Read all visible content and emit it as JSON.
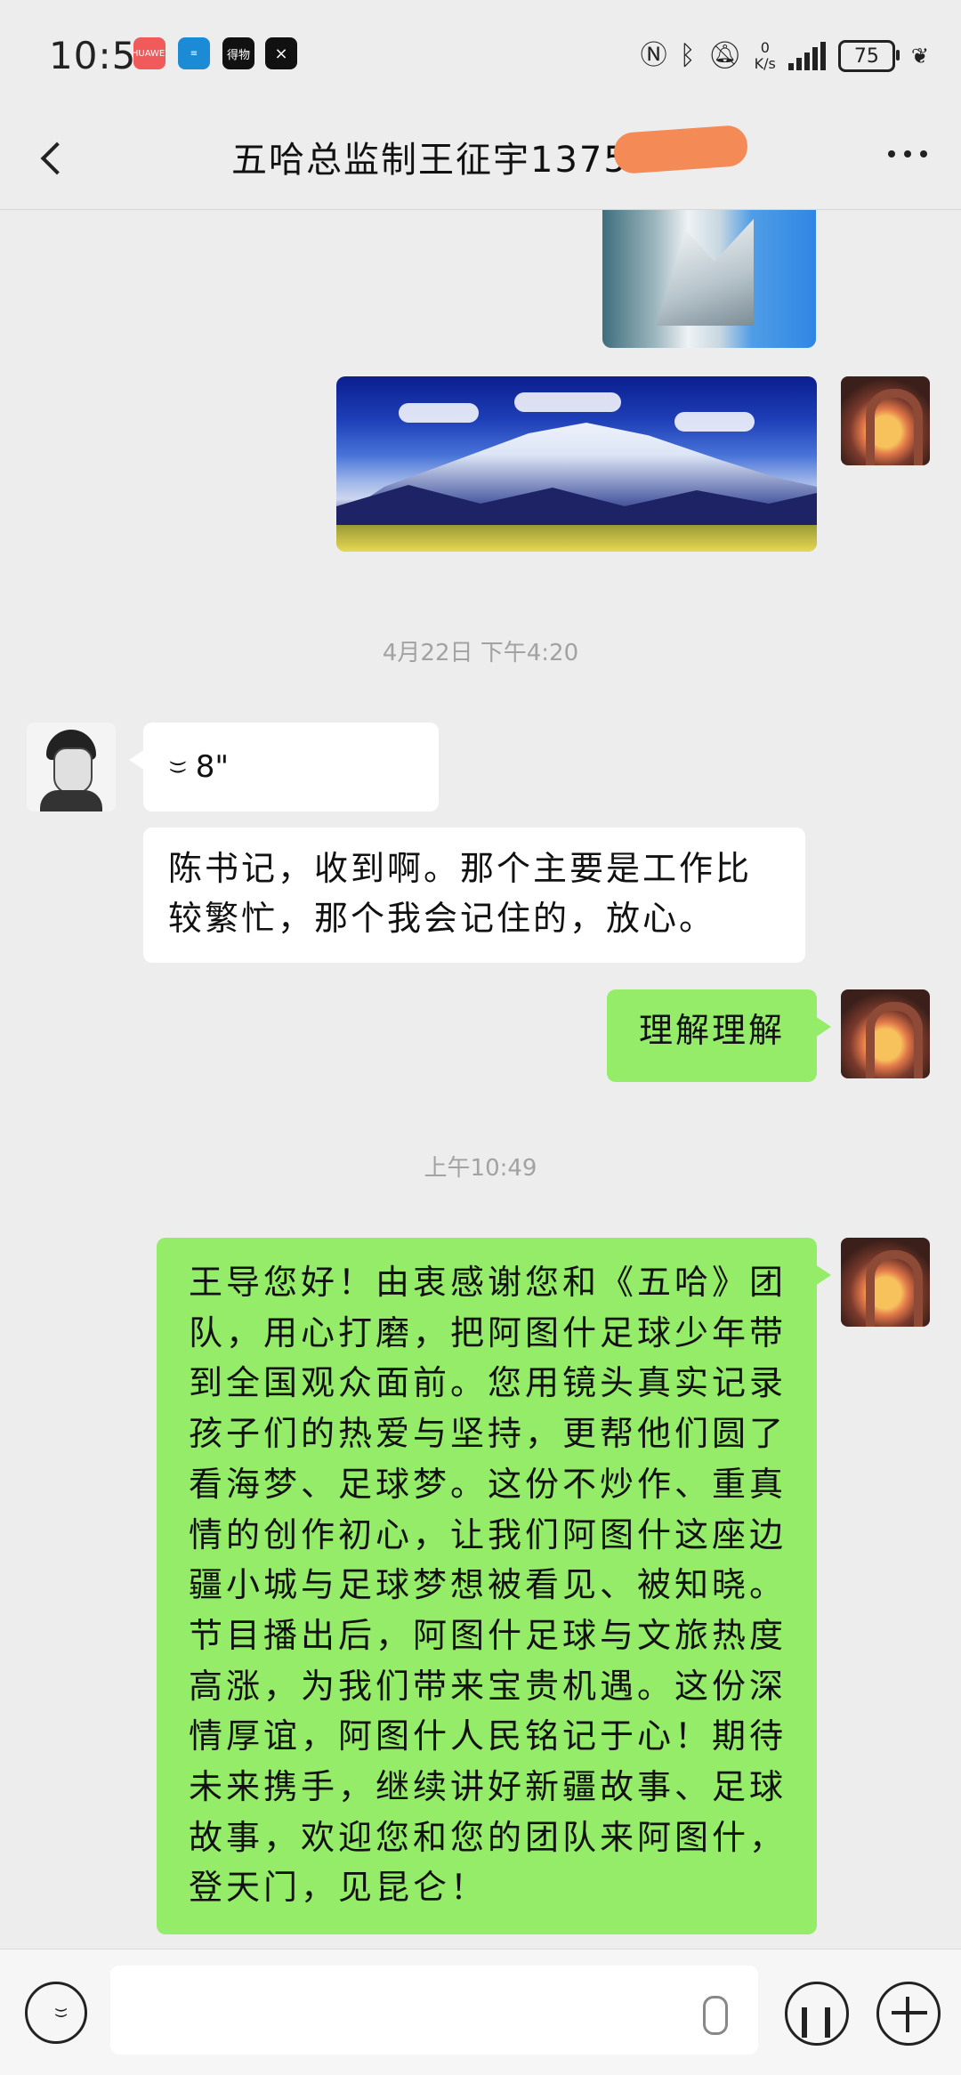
{
  "status_bar": {
    "time": "10:50",
    "apps": [
      "HUAWEI",
      "≡",
      "得物",
      "⨯"
    ],
    "net_speed_value": "0",
    "net_speed_unit": "K/s",
    "battery": "75",
    "icons": [
      "nfc-icon",
      "bluetooth-icon",
      "mute-icon",
      "signal-icon",
      "battery-icon",
      "leaf-icon"
    ]
  },
  "header": {
    "title": "五哈总监制王征宇1375"
  },
  "messages": {
    "ts1": "4月22日 下午4:20",
    "voice_duration": "8\"",
    "reply": "陈书记，收到啊。那个主要是工作比较繁忙，那个我会记住的，放心。",
    "understand": "理解理解",
    "ts2": "上午10:49",
    "long": "王导您好！由衷感谢您和《五哈》团队，用心打磨，把阿图什足球少年带到全国观众面前。您用镜头真实记录孩子们的热爱与坚持，更帮他们圆了看海梦、足球梦。这份不炒作、重真情的创作初心，让我们阿图什这座边疆小城与足球梦想被看见、被知晓。节目播出后，阿图什足球与文旅热度高涨，为我们带来宝贵机遇。这份深情厚谊，阿图什人民铭记于心！期待未来携手，继续讲好新疆故事、足球故事，欢迎您和您的团队来阿图什，登天门，见昆仑！"
  },
  "input": {
    "value": ""
  },
  "colors": {
    "background": "#ededed",
    "self_bubble": "#95ec69",
    "other_bubble": "#ffffff",
    "redaction": "#f48a56"
  }
}
